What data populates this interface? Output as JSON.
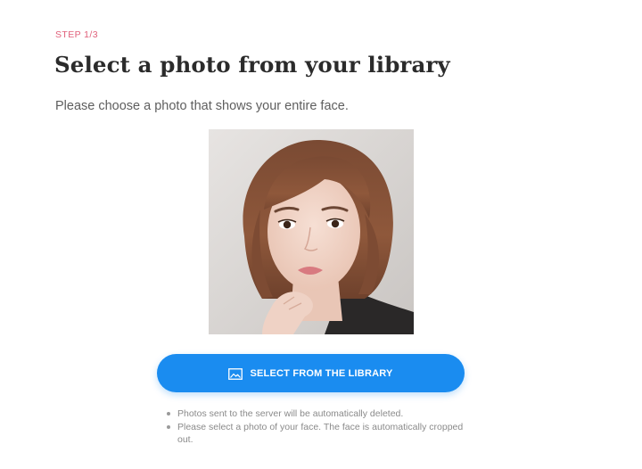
{
  "step": {
    "label": "STEP 1/3"
  },
  "header": {
    "title": "Select a photo from your library",
    "subtitle": "Please choose a photo that shows your entire face."
  },
  "photo": {
    "alt": "Portrait photo of a woman with shoulder-length auburn hair, hand near chin"
  },
  "action": {
    "icon": "image-icon",
    "label": "SELECT FROM THE LIBRARY"
  },
  "notes": [
    "Photos sent to the server will be automatically deleted.",
    "Please select a photo of your face. The face is automatically cropped out."
  ],
  "colors": {
    "accent": "#1a8cf0",
    "step": "#e0607a"
  }
}
